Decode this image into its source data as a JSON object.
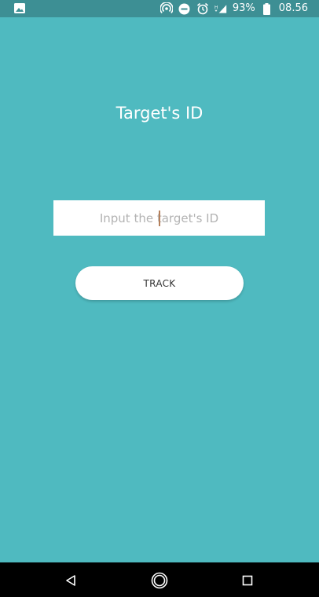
{
  "status_bar": {
    "battery": "93%",
    "time": "08.56",
    "icons": [
      "image-icon",
      "hotspot-icon",
      "do-not-disturb-icon",
      "alarm-icon",
      "signal-icon",
      "battery-icon"
    ]
  },
  "title": "Target's ID",
  "id_input": {
    "placeholder": "Input the target's ID",
    "value": ""
  },
  "track_button": {
    "label": "TRACK"
  },
  "nav_bar": {
    "icons": [
      "back-icon",
      "home-icon",
      "recents-icon"
    ]
  },
  "colors": {
    "background": "#4fbac0",
    "status_bar": "#3d8f94",
    "input_bg": "#ffffff",
    "button_bg": "#ffffff",
    "nav_bar": "#000000"
  }
}
